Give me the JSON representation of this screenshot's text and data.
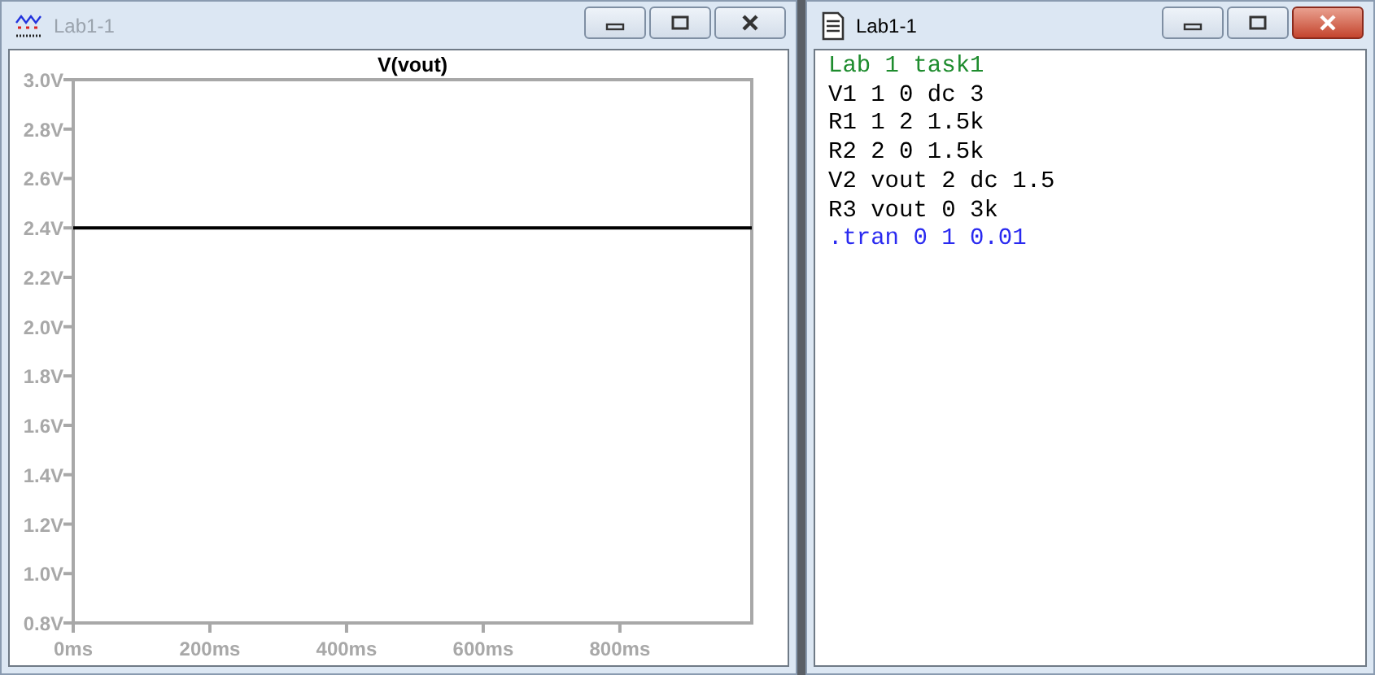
{
  "plot_window": {
    "title": "Lab1-1",
    "active": false,
    "chart_data": {
      "type": "line",
      "x": [
        0,
        993
      ],
      "series": [
        {
          "name": "V(vout)",
          "color": "#000000",
          "values": [
            2.4,
            2.4
          ]
        }
      ],
      "xlim": [
        0,
        993
      ],
      "ylim": [
        0.8,
        3.0
      ],
      "xticks": [
        {
          "value": 0,
          "label": "0ms"
        },
        {
          "value": 200,
          "label": "200ms"
        },
        {
          "value": 400,
          "label": "400ms"
        },
        {
          "value": 600,
          "label": "600ms"
        },
        {
          "value": 800,
          "label": "800ms"
        }
      ],
      "yticks": [
        {
          "value": 3.0,
          "label": "3.0V"
        },
        {
          "value": 2.8,
          "label": "2.8V"
        },
        {
          "value": 2.6,
          "label": "2.6V"
        },
        {
          "value": 2.4,
          "label": "2.4V"
        },
        {
          "value": 2.2,
          "label": "2.2V"
        },
        {
          "value": 2.0,
          "label": "2.0V"
        },
        {
          "value": 1.8,
          "label": "1.8V"
        },
        {
          "value": 1.6,
          "label": "1.6V"
        },
        {
          "value": 1.4,
          "label": "1.4V"
        },
        {
          "value": 1.2,
          "label": "1.2V"
        },
        {
          "value": 1.0,
          "label": "1.0V"
        },
        {
          "value": 0.8,
          "label": "0.8V"
        }
      ]
    }
  },
  "netlist_window": {
    "title": "Lab1-1",
    "active": true,
    "lines": [
      {
        "kind": "comment",
        "text": "Lab 1 task1"
      },
      {
        "kind": "statement",
        "text": "V1 1 0 dc 3"
      },
      {
        "kind": "statement",
        "text": "R1 1 2 1.5k"
      },
      {
        "kind": "statement",
        "text": "R2 2 0 1.5k"
      },
      {
        "kind": "statement",
        "text": "V2 vout 2 dc 1.5"
      },
      {
        "kind": "statement",
        "text": "R3 vout 0 3k"
      },
      {
        "kind": "directive",
        "text": ".tran 0 1 0.01"
      }
    ]
  }
}
